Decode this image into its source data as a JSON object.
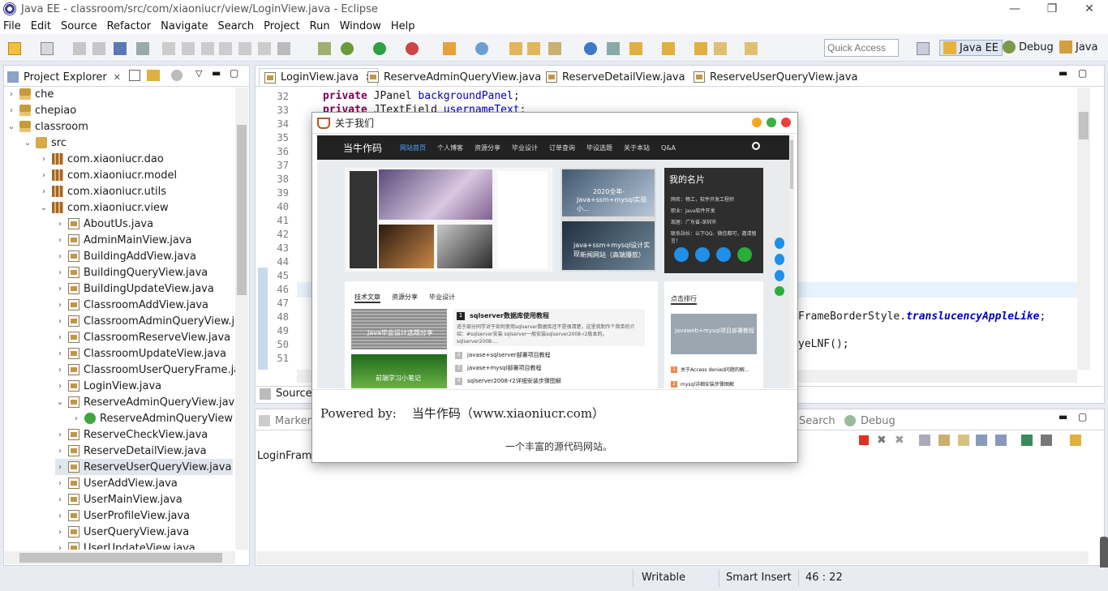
{
  "window": {
    "title": "Java EE - classroom/src/com/xiaoniucr/view/LoginView.java - Eclipse",
    "minimize": "—",
    "maximize": "❐",
    "close": "✕"
  },
  "menu": [
    "File",
    "Edit",
    "Source",
    "Refactor",
    "Navigate",
    "Search",
    "Project",
    "Run",
    "Window",
    "Help"
  ],
  "toolbar": {
    "quick_access_placeholder": "Quick Access",
    "perspectives": [
      "Java EE",
      "Debug",
      "Java"
    ]
  },
  "project_explorer": {
    "title": "Project Explorer",
    "items": [
      {
        "label": "che",
        "expanded": false,
        "level": 0,
        "icon": "project-icon"
      },
      {
        "label": "chepiao",
        "expanded": false,
        "level": 0,
        "icon": "project-icon"
      },
      {
        "label": "classroom",
        "expanded": true,
        "level": 0,
        "icon": "project-icon"
      },
      {
        "label": "src",
        "expanded": true,
        "level": 1,
        "icon": "source-folder-icon"
      },
      {
        "label": "com.xiaoniucr.dao",
        "expanded": false,
        "level": 2,
        "icon": "package-icon"
      },
      {
        "label": "com.xiaoniucr.model",
        "expanded": false,
        "level": 2,
        "icon": "package-icon"
      },
      {
        "label": "com.xiaoniucr.utils",
        "expanded": false,
        "level": 2,
        "icon": "package-icon"
      },
      {
        "label": "com.xiaoniucr.view",
        "expanded": true,
        "level": 2,
        "icon": "package-icon"
      },
      {
        "label": "AboutUs.java",
        "expanded": false,
        "level": 3,
        "icon": "java-file-icon"
      },
      {
        "label": "AdminMainView.java",
        "expanded": false,
        "level": 3,
        "icon": "java-file-icon"
      },
      {
        "label": "BuildingAddView.java",
        "expanded": false,
        "level": 3,
        "icon": "java-file-icon"
      },
      {
        "label": "BuildingQueryView.java",
        "expanded": false,
        "level": 3,
        "icon": "java-file-icon"
      },
      {
        "label": "BuildingUpdateView.java",
        "expanded": false,
        "level": 3,
        "icon": "java-file-icon"
      },
      {
        "label": "ClassroomAddView.java",
        "expanded": false,
        "level": 3,
        "icon": "java-file-icon"
      },
      {
        "label": "ClassroomAdminQueryView.java",
        "expanded": false,
        "level": 3,
        "icon": "java-file-icon"
      },
      {
        "label": "ClassroomReserveView.java",
        "expanded": false,
        "level": 3,
        "icon": "java-file-icon"
      },
      {
        "label": "ClassroomUpdateView.java",
        "expanded": false,
        "level": 3,
        "icon": "java-file-icon"
      },
      {
        "label": "ClassroomUserQueryFrame.java",
        "expanded": false,
        "level": 3,
        "icon": "java-file-icon"
      },
      {
        "label": "LoginView.java",
        "expanded": false,
        "level": 3,
        "icon": "java-file-icon"
      },
      {
        "label": "ReserveAdminQueryView.java",
        "expanded": true,
        "level": 3,
        "icon": "java-file-icon"
      },
      {
        "label": "ReserveAdminQueryView",
        "expanded": false,
        "level": 4,
        "icon": "class-icon"
      },
      {
        "label": "ReserveCheckView.java",
        "expanded": false,
        "level": 3,
        "icon": "java-file-icon"
      },
      {
        "label": "ReserveDetailView.java",
        "expanded": false,
        "level": 3,
        "icon": "java-file-icon"
      },
      {
        "label": "ReserveUserQueryView.java",
        "expanded": false,
        "level": 3,
        "icon": "java-file-icon",
        "selected": true
      },
      {
        "label": "UserAddView.java",
        "expanded": false,
        "level": 3,
        "icon": "java-file-icon"
      },
      {
        "label": "UserMainView.java",
        "expanded": false,
        "level": 3,
        "icon": "java-file-icon"
      },
      {
        "label": "UserProfileView.java",
        "expanded": false,
        "level": 3,
        "icon": "java-file-icon"
      },
      {
        "label": "UserQueryView.java",
        "expanded": false,
        "level": 3,
        "icon": "java-file-icon"
      },
      {
        "label": "UserUpdateView.java",
        "expanded": false,
        "level": 3,
        "icon": "java-file-icon"
      }
    ]
  },
  "editor": {
    "tabs": [
      "LoginView.java",
      "ReserveAdminQueryView.java",
      "ReserveDetailView.java",
      "ReserveUserQueryView.java"
    ],
    "line_numbers": [
      "32",
      "33",
      "34",
      "35",
      "36",
      "37",
      "38",
      "39",
      "40",
      "41",
      "42",
      "43",
      "44",
      "45",
      "46",
      "47",
      "48",
      "49",
      "50",
      "51"
    ],
    "line32": {
      "kw": "private",
      "type": " JPanel ",
      "field": "backgroundPanel",
      "end": ";"
    },
    "line33": {
      "kw": "private",
      "type": " JTextField ",
      "field": "usernameText",
      "end": ";"
    },
    "line48_tail": "FrameBorderStyle.",
    "line48_field": "translucencyAppleLike",
    "line48_end": ";",
    "line50_tail": "yeLNF();",
    "bottom_tab": "Source"
  },
  "bottom_panel": {
    "tab_markers": "Marker",
    "content": "LoginFrame",
    "tab_search": "Search",
    "tab_debug": "Debug"
  },
  "dialog": {
    "title": "关于我们",
    "powered_by": "Powered by:    当牛作码（www.xiaoniucr.com）",
    "tagline": "一个丰富的源代码网站。",
    "site": {
      "brand": "当牛作码",
      "nav": [
        "网站首页",
        "个人博客",
        "资源分享",
        "毕业设计",
        "订单查询",
        "毕设选题",
        "关于本站",
        "Q&A"
      ],
      "card_title": "我的名片",
      "card_lines": [
        "网名：畅工，软件开发工程师",
        "职业：Java软件开发",
        "现居：广东省-深圳市",
        "联系站长：以下QQ、微信都可，邀请留言！"
      ],
      "thumb1": "2020全年-",
      "thumb1b": "Java+ssm+mysql实现小...",
      "thumb2": "java+ssm+mysql设计实现",
      "thumb2b": "新闻网站（高端爆款）",
      "tabs": [
        "技术文章",
        "资源分享",
        "毕业设计"
      ],
      "article_title": "sqlserver数据库使用教程",
      "article_desc": "适于部分同学对于如何使用sqlserver数据库还不是很清楚，这里我制作个简单的介绍：#sqlserver安装 sqlserver一般安装sqlserver2008-r2版本的。sqlserver2008-...",
      "list": [
        "javase+sqlserver部署项目教程",
        "javase+mysql部署项目教程",
        "sqlserver2008-r2详细安装步骤图解"
      ],
      "list_nums": [
        "1",
        "2",
        "3",
        "4"
      ],
      "img_caption1": "Java毕业设计选题分享",
      "img_caption2": "前端学习小笔记",
      "rank_title": "点击排行",
      "rank_img": "javaweb+mysql项目部署教程",
      "rank_list": [
        "关于Access denied问题的解...",
        "mysql详细安装步骤图解"
      ],
      "rank_nums": [
        "1",
        "2"
      ]
    }
  },
  "statusbar": {
    "writable": "Writable",
    "insert_mode": "Smart Insert",
    "position": "46 : 22"
  }
}
